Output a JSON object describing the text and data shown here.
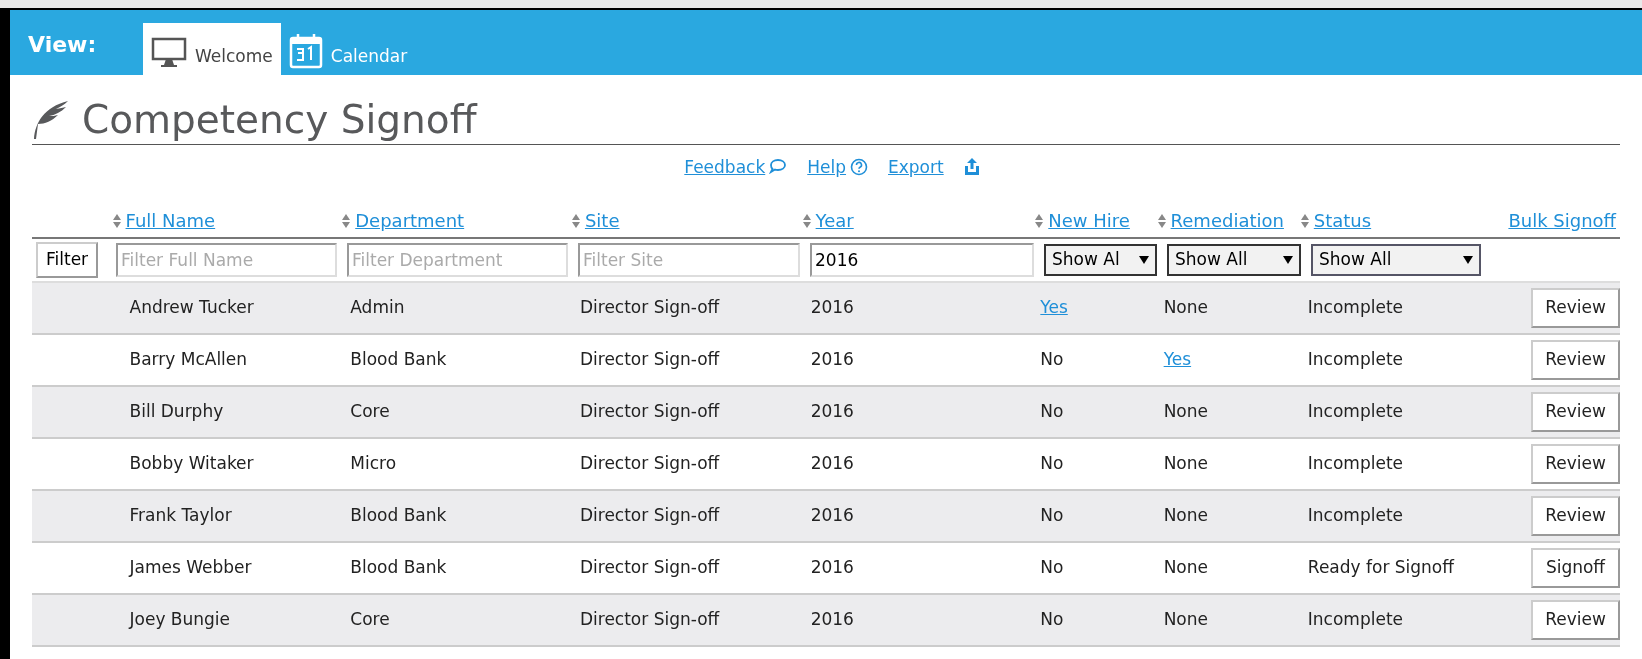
{
  "header": {
    "label": "View:",
    "tabs": [
      {
        "label": "Welcome",
        "selected": true
      },
      {
        "label": "Calendar",
        "selected": false
      }
    ]
  },
  "page": {
    "title": "Competency Signoff",
    "links": [
      {
        "label": "Feedback"
      },
      {
        "label": "Help"
      },
      {
        "label": "Export"
      }
    ]
  },
  "table": {
    "columns": [
      {
        "label": "Full Name",
        "sortable": true
      },
      {
        "label": "Department",
        "sortable": true
      },
      {
        "label": "Site",
        "sortable": true
      },
      {
        "label": "Year",
        "sortable": true
      },
      {
        "label": "New Hire",
        "sortable": true
      },
      {
        "label": "Remediation",
        "sortable": true
      },
      {
        "label": "Status",
        "sortable": true
      },
      {
        "label": "Bulk Signoff",
        "sortable": false
      }
    ],
    "filter_button": "Filter",
    "filters": [
      {
        "kind": "text",
        "placeholder": "Filter Full Name"
      },
      {
        "kind": "text",
        "placeholder": "Filter Department"
      },
      {
        "kind": "text",
        "placeholder": "Filter Site"
      },
      {
        "kind": "text",
        "value": "2016"
      },
      {
        "kind": "select",
        "value": "Show Al"
      },
      {
        "kind": "select",
        "value": "Show All"
      },
      {
        "kind": "select",
        "value": "Show All"
      }
    ],
    "rows": [
      {
        "name": "Andrew Tucker",
        "department": "Admin",
        "site": "Director Sign-off",
        "year": "2016",
        "new_hire": {
          "text": "Yes",
          "link": true
        },
        "remediation": {
          "text": "None",
          "link": false
        },
        "status": "Incomplete",
        "action": "Review"
      },
      {
        "name": "Barry McAllen",
        "department": "Blood Bank",
        "site": "Director Sign-off",
        "year": "2016",
        "new_hire": {
          "text": "No",
          "link": false
        },
        "remediation": {
          "text": "Yes",
          "link": true
        },
        "status": "Incomplete",
        "action": "Review"
      },
      {
        "name": "Bill Durphy",
        "department": "Core",
        "site": "Director Sign-off",
        "year": "2016",
        "new_hire": {
          "text": "No",
          "link": false
        },
        "remediation": {
          "text": "None",
          "link": false
        },
        "status": "Incomplete",
        "action": "Review"
      },
      {
        "name": "Bobby Witaker",
        "department": "Micro",
        "site": "Director Sign-off",
        "year": "2016",
        "new_hire": {
          "text": "No",
          "link": false
        },
        "remediation": {
          "text": "None",
          "link": false
        },
        "status": "Incomplete",
        "action": "Review"
      },
      {
        "name": "Frank Taylor",
        "department": "Blood Bank",
        "site": "Director Sign-off",
        "year": "2016",
        "new_hire": {
          "text": "No",
          "link": false
        },
        "remediation": {
          "text": "None",
          "link": false
        },
        "status": "Incomplete",
        "action": "Review"
      },
      {
        "name": "James Webber",
        "department": "Blood Bank",
        "site": "Director Sign-off",
        "year": "2016",
        "new_hire": {
          "text": "No",
          "link": false
        },
        "remediation": {
          "text": "None",
          "link": false
        },
        "status": "Ready for Signoff",
        "action": "Signoff"
      },
      {
        "name": "Joey Bungie",
        "department": "Core",
        "site": "Director Sign-off",
        "year": "2016",
        "new_hire": {
          "text": "No",
          "link": false
        },
        "remediation": {
          "text": "None",
          "link": false
        },
        "status": "Incomplete",
        "action": "Review"
      }
    ]
  }
}
